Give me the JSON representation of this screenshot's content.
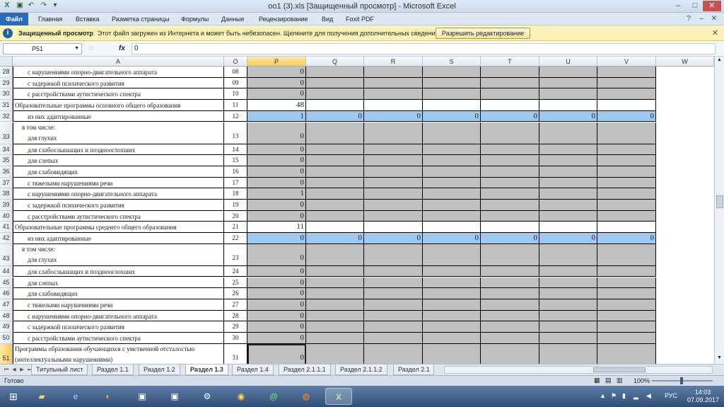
{
  "title_bar": {
    "title": "oo1 (3).xls  [Защищенный просмотр]  -  Microsoft Excel",
    "minimize": "–",
    "maximize": "□",
    "close": "✕"
  },
  "ribbon": {
    "tabs": [
      {
        "label": "Файл"
      },
      {
        "label": "Главная"
      },
      {
        "label": "Вставка"
      },
      {
        "label": "Разметка страницы"
      },
      {
        "label": "Формулы"
      },
      {
        "label": "Данные"
      },
      {
        "label": "Рецензирование"
      },
      {
        "label": "Вид"
      },
      {
        "label": "Foxit PDF"
      }
    ]
  },
  "protected_view": {
    "title": "Защищенный просмотр",
    "message": "Этот файл загружен из Интернета и может быть небезопасен. Щелкните для получения дополнительных сведений.",
    "button": "Разрешить редактирование",
    "close": "✕"
  },
  "formula_bar": {
    "name_box": "P51",
    "fx": "fx",
    "value": "0"
  },
  "columns": [
    "A",
    "O",
    "P",
    "Q",
    "R",
    "S",
    "T",
    "U",
    "V",
    "W"
  ],
  "selected_column": "P",
  "rows": [
    {
      "n": "28",
      "label": "с нарушениями опорно-двигательного аппарата",
      "indent": 2,
      "code": "08",
      "p": "0",
      "row_type": "gray"
    },
    {
      "n": "29",
      "label": "с задержкой психического развития",
      "indent": 2,
      "code": "09",
      "p": "0",
      "row_type": "gray"
    },
    {
      "n": "30",
      "label": "с расстройствами аутистического спектра",
      "indent": 2,
      "code": "10",
      "p": "0",
      "row_type": "gray"
    },
    {
      "n": "31",
      "label": "Образовательные программы основного общего образования",
      "indent": 0,
      "code": "11",
      "p": "48",
      "row_type": "white"
    },
    {
      "n": "32",
      "label": "из них адаптированные",
      "indent": 1,
      "code": "12",
      "p": "1",
      "row_type": "blue",
      "extra": [
        "0",
        "0",
        "0",
        "0",
        "0",
        "0"
      ]
    },
    {
      "n": "33",
      "label": "в том числе:",
      "label2": "для глухих",
      "indent": 1,
      "code": "13",
      "p": "0",
      "row_type": "gray",
      "tall": true
    },
    {
      "n": "34",
      "label": "для слабослышащих и позднооглохших",
      "indent": 2,
      "code": "14",
      "p": "0",
      "row_type": "gray"
    },
    {
      "n": "35",
      "label": "для слепых",
      "indent": 2,
      "code": "15",
      "p": "0",
      "row_type": "gray"
    },
    {
      "n": "36",
      "label": "для слабовидящих",
      "indent": 2,
      "code": "16",
      "p": "0",
      "row_type": "gray"
    },
    {
      "n": "37",
      "label": "с тяжелыми нарушениями речи",
      "indent": 2,
      "code": "17",
      "p": "0",
      "row_type": "gray"
    },
    {
      "n": "38",
      "label": "с нарушениями опорно-двигательного аппарата",
      "indent": 2,
      "code": "18",
      "p": "1",
      "row_type": "gray"
    },
    {
      "n": "39",
      "label": "с задержкой психического развития",
      "indent": 2,
      "code": "19",
      "p": "0",
      "row_type": "gray"
    },
    {
      "n": "40",
      "label": "с расстройствами аутистического спектра",
      "indent": 2,
      "code": "20",
      "p": "0",
      "row_type": "gray"
    },
    {
      "n": "41",
      "label": "Образовательные программы среднего общего образования",
      "indent": 0,
      "code": "21",
      "p": "11",
      "row_type": "white"
    },
    {
      "n": "42",
      "label": "из них адаптированные",
      "indent": 1,
      "code": "22",
      "p": "0",
      "row_type": "blue",
      "extra": [
        "0",
        "0",
        "0",
        "0",
        "0",
        "0"
      ]
    },
    {
      "n": "43",
      "label": "в том числе:",
      "label2": "для глухих",
      "indent": 1,
      "code": "23",
      "p": "0",
      "row_type": "gray",
      "tall": true
    },
    {
      "n": "44",
      "label": "для слабослышащих и позднооглохших",
      "indent": 2,
      "code": "24",
      "p": "0",
      "row_type": "gray"
    },
    {
      "n": "45",
      "label": "для слепых",
      "indent": 2,
      "code": "25",
      "p": "0",
      "row_type": "gray"
    },
    {
      "n": "46",
      "label": "для слабовидящих",
      "indent": 2,
      "code": "26",
      "p": "0",
      "row_type": "gray"
    },
    {
      "n": "47",
      "label": "с тяжелыми нарушениями речи",
      "indent": 2,
      "code": "27",
      "p": "0",
      "row_type": "gray"
    },
    {
      "n": "48",
      "label": "с нарушениями опорно-двигательного аппарата",
      "indent": 2,
      "code": "28",
      "p": "0",
      "row_type": "gray"
    },
    {
      "n": "49",
      "label": "с задержкой психического развития",
      "indent": 2,
      "code": "29",
      "p": "0",
      "row_type": "gray"
    },
    {
      "n": "50",
      "label": "с расстройствами аутистического спектра",
      "indent": 2,
      "code": "30",
      "p": "0",
      "row_type": "gray"
    },
    {
      "n": "51",
      "label": "Программы образования обучающихся с умственной отсталостью",
      "label2": "(интеллектуальными нарушениями)",
      "indent": 0,
      "code": "31",
      "p": "0",
      "row_type": "gray",
      "tall": true,
      "selected": true
    }
  ],
  "sheet_tabs": [
    {
      "label": "Титульный лист"
    },
    {
      "label": "Раздел 1.1"
    },
    {
      "label": "Раздел 1.2"
    },
    {
      "label": "Раздел 1.3",
      "active": true
    },
    {
      "label": "Раздел 1.4"
    },
    {
      "label": "Раздел 2.1.1.1"
    },
    {
      "label": "Раздел 2.1.1.2"
    },
    {
      "label": "Раздел 2.1"
    }
  ],
  "status": {
    "ready": "Готово",
    "zoom": "100%",
    "zoom_level": 1.0
  },
  "taskbar": {
    "icons": [
      "windows-start",
      "file-explorer",
      "internet-explorer",
      "app-globe",
      "app-kvadro-1",
      "app-kvadro-2",
      "app-tools",
      "chrome",
      "messenger",
      "firefox",
      "excel"
    ],
    "language": "РУС",
    "time": "14:03",
    "date": "07.09.2017"
  },
  "colors": {
    "gray_cell": "#c0c0c0",
    "blue_cell": "#9cc8f2",
    "selection": "#f6cc5a",
    "annotation": "#e0141e"
  }
}
